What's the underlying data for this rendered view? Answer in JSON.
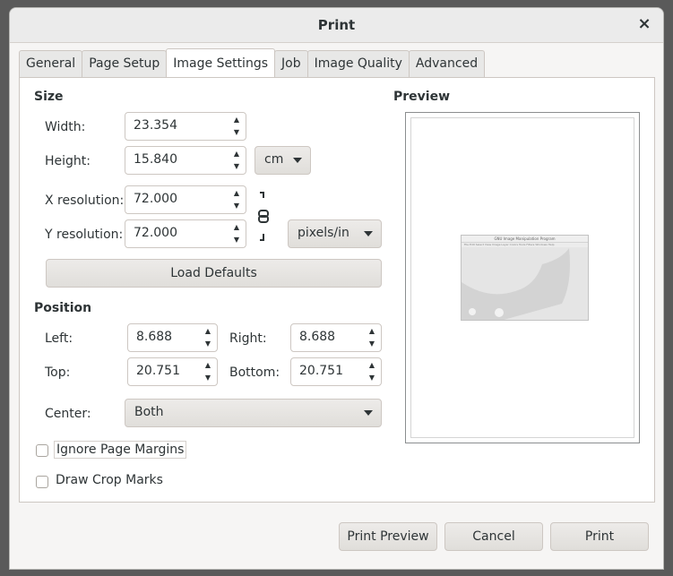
{
  "window": {
    "title": "Print",
    "close_glyph": "×"
  },
  "tabs": [
    "General",
    "Page Setup",
    "Image Settings",
    "Job",
    "Image Quality",
    "Advanced"
  ],
  "active_tab": "Image Settings",
  "size": {
    "header": "Size",
    "width_label": "Width:",
    "width_value": "23.354",
    "height_label": "Height:",
    "height_value": "15.840",
    "size_unit": "cm",
    "xres_label": "X resolution:",
    "xres_value": "72.000",
    "yres_label": "Y resolution:",
    "yres_value": "72.000",
    "res_unit": "pixels/in",
    "load_defaults": "Load Defaults"
  },
  "position": {
    "header": "Position",
    "left_label": "Left:",
    "left_value": "8.688",
    "right_label": "Right:",
    "right_value": "8.688",
    "top_label": "Top:",
    "top_value": "20.751",
    "bottom_label": "Bottom:",
    "bottom_value": "20.751",
    "center_label": "Center:",
    "center_value": "Both"
  },
  "options": {
    "ignore_margins": "Ignore Page Margins",
    "draw_crop_marks": "Draw Crop Marks",
    "ignore_margins_checked": false,
    "draw_crop_marks_checked": false
  },
  "preview": {
    "header": "Preview",
    "thumb_title": "GNU Image Manipulation Program",
    "thumb_menu": "File  Edit  Select  View  Image  Layer  Colors  Tools  Filters  Windows  Help"
  },
  "footer": {
    "print_preview": "Print Preview",
    "cancel": "Cancel",
    "print": "Print"
  },
  "icons": {
    "spin_up": "▲",
    "spin_down": "▼"
  }
}
